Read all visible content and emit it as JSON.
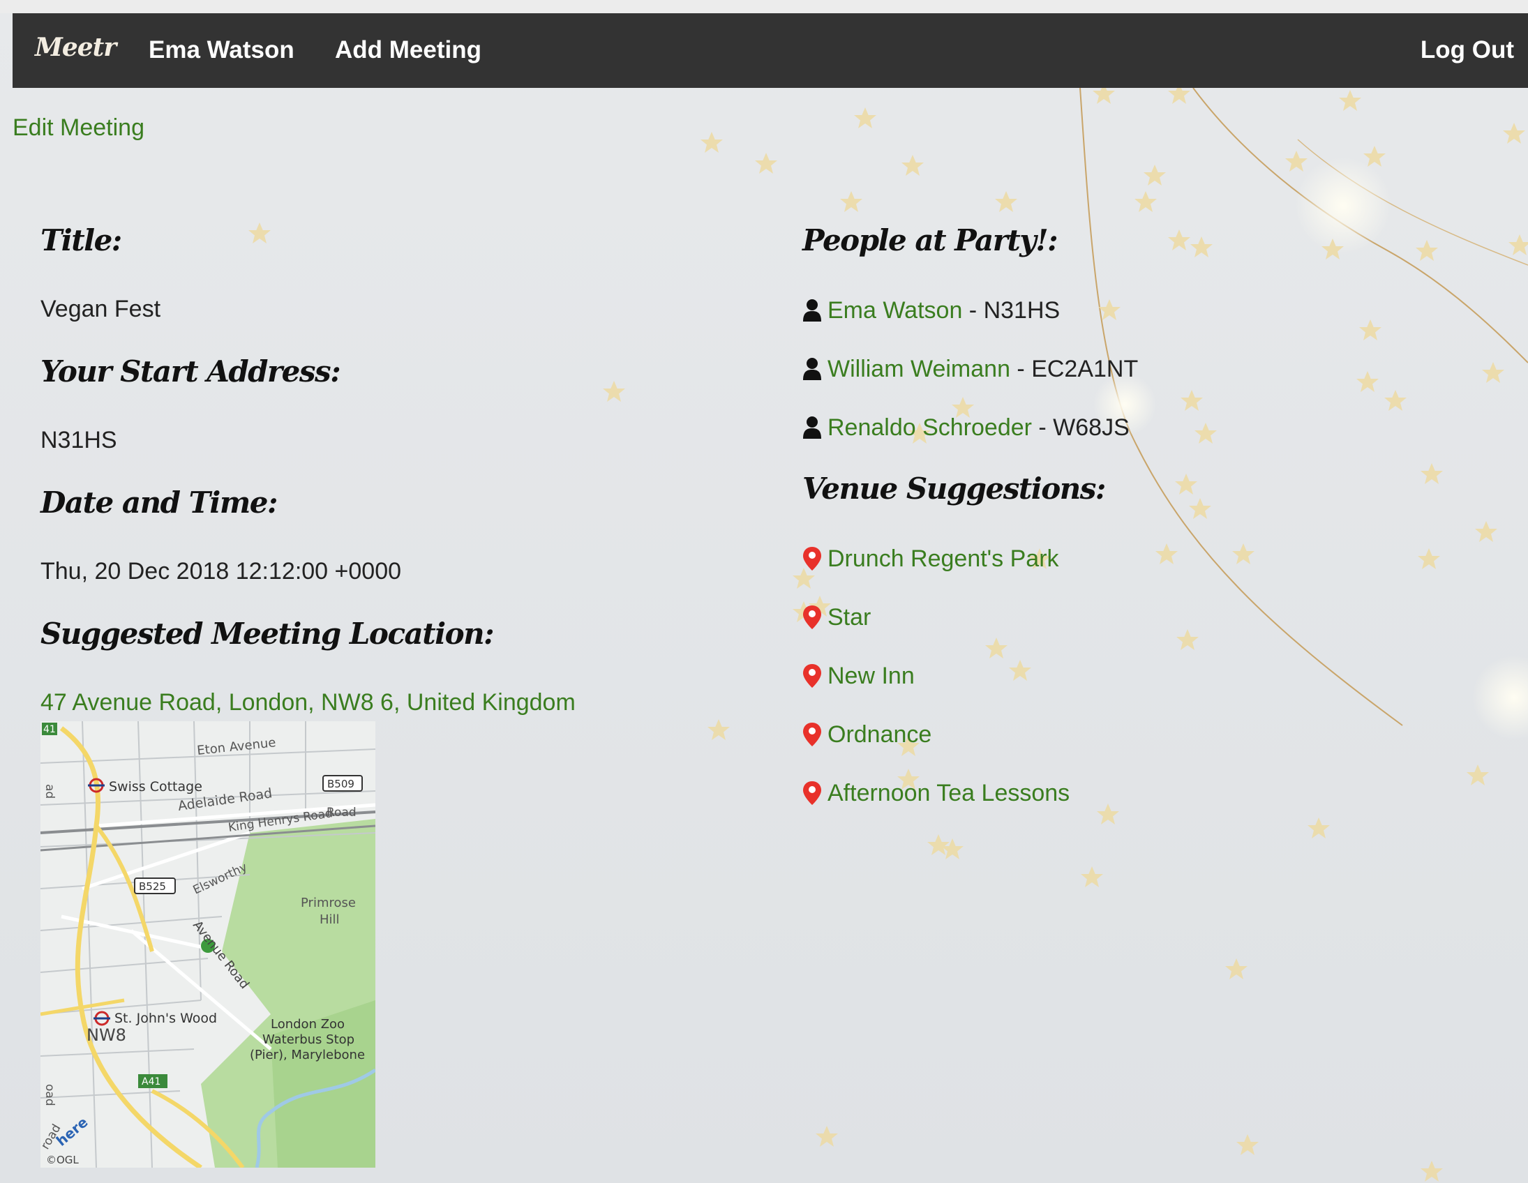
{
  "navbar": {
    "brand": "Meetr",
    "user_link": "Ema Watson",
    "add_meeting": "Add Meeting",
    "logout": "Log Out"
  },
  "edit_link": "Edit Meeting",
  "meeting": {
    "title_heading": "Title:",
    "title": "Vegan Fest",
    "start_heading": "Your Start Address:",
    "start_address": "N31HS",
    "datetime_heading": "Date and Time:",
    "datetime": "Thu, 20 Dec 2018 12:12:00 +0000",
    "location_heading": "Suggested Meeting Location:",
    "location": "47 Avenue Road, London, NW8 6, United Kingdom"
  },
  "map": {
    "labels": {
      "eton": "Eton Avenue",
      "swiss": "Swiss Cottage",
      "adelaide": "Adelaide Road",
      "b509": "B509",
      "king": "King Henrys Road",
      "road": "Road",
      "b525": "B525",
      "elsworthy": "Elsworthy",
      "primrose": "Primrose",
      "hill": "Hill",
      "avenue_road": "Avenue Road",
      "stjohns": "St. John's Wood",
      "nw8": "NW8",
      "zoo1": "London Zoo",
      "zoo2": "Waterbus Stop",
      "zoo3": "(Pier), Marylebone",
      "a41": "A41",
      "a41top": "41",
      "here": "here",
      "ogl": "©OGL",
      "road_left": "oad",
      "road_left2": "ad",
      "road_bottom": "road"
    }
  },
  "people": {
    "heading": "People at Party!:",
    "list": [
      {
        "name": "Ema Watson",
        "code": " - N31HS"
      },
      {
        "name": "William Weimann",
        "code": " - EC2A1NT"
      },
      {
        "name": "Renaldo Schroeder",
        "code": " - W68JS"
      }
    ]
  },
  "venues": {
    "heading": "Venue Suggestions:",
    "list": [
      {
        "name": "Drunch Regent's Park"
      },
      {
        "name": "Star"
      },
      {
        "name": "New Inn"
      },
      {
        "name": "Ordnance"
      },
      {
        "name": "Afternoon Tea Lessons"
      }
    ]
  },
  "colors": {
    "navbar": "#333333",
    "link_green": "#3a7d1f",
    "pin_red": "#e8312a",
    "star_gold": "#e6d39a"
  },
  "icons": {
    "person": "user-icon",
    "venue": "map-pin-icon"
  }
}
